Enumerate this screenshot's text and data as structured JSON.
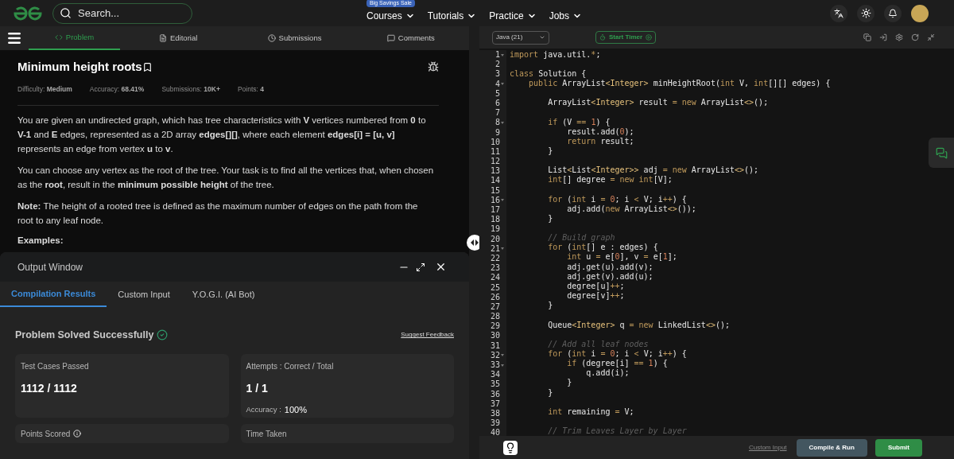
{
  "topbar": {
    "search": {
      "placeholder": "Search..."
    },
    "sale_badge": "Big Savings Sale",
    "nav": [
      {
        "label": "Courses"
      },
      {
        "label": "Tutorials"
      },
      {
        "label": "Practice"
      },
      {
        "label": "Jobs"
      }
    ]
  },
  "problem_tabs": [
    {
      "label": "Problem",
      "selected": true
    },
    {
      "label": "Editorial",
      "selected": false
    },
    {
      "label": "Submissions",
      "selected": false
    },
    {
      "label": "Comments",
      "selected": false
    }
  ],
  "problem": {
    "title": "Minimum height roots",
    "meta": [
      {
        "label": "Difficulty:",
        "value": "Medium"
      },
      {
        "label": "Accuracy:",
        "value": "68.41%"
      },
      {
        "label": "Submissions:",
        "value": "10K+"
      },
      {
        "label": "Points:",
        "value": "4"
      }
    ],
    "paragraphs": [
      "You are given an undirected graph, which has tree characteristics with **V** vertices numbered from **0** to **V-1** and **E** edges, represented as a 2D array **edges[][]**, where each element **edges[i] = [u, v]** represents an edge from vertex **u** to **v**.",
      "You can choose any vertex as the root of the tree. Your task is to find all the vertices that, when chosen as the **root**, result in the **minimum possible height** of the tree.",
      "**Note:** The height of a rooted tree is defined as the maximum number of edges on the path from the root to any leaf node."
    ],
    "examples_heading": "Examples:"
  },
  "output_window": {
    "title": "Output Window",
    "tabs": [
      {
        "label": "Compilation Results",
        "selected": true
      },
      {
        "label": "Custom Input",
        "selected": false
      },
      {
        "label": "Y.O.G.I. (AI Bot)",
        "selected": false
      }
    ],
    "status": "Problem Solved Successfully",
    "feedback_link": "Suggest Feedback",
    "cards": [
      {
        "label": "Test Cases Passed",
        "value": "1112 / 1112"
      },
      {
        "label": "Attempts : Correct / Total",
        "value": "1 / 1",
        "sub_label": "Accuracy :",
        "sub_value": "100%"
      },
      {
        "label": "Points Scored",
        "info": true
      },
      {
        "label": "Time Taken"
      }
    ]
  },
  "editor": {
    "language": "Java (21)",
    "timer_button": "Start Timer",
    "lines": [
      {
        "n": "1",
        "fold": true,
        "tokens": [
          {
            "kind": "kw",
            "text": "import"
          },
          {
            "kind": "plain",
            "text": " java.util."
          },
          {
            "kind": "kw",
            "text": "*"
          },
          {
            "kind": "plain",
            "text": ";"
          }
        ]
      },
      {
        "n": "2",
        "fold": false
      },
      {
        "n": "3",
        "fold": false,
        "tokens": [
          {
            "kind": "kw",
            "text": "class"
          },
          {
            "kind": "plain",
            "text": " Solution {"
          }
        ]
      },
      {
        "n": "4",
        "fold": true,
        "tokens": [
          {
            "kind": "kw",
            "text": "    public"
          },
          {
            "kind": "plain",
            "text": " ArrayList"
          },
          {
            "kind": "type",
            "text": "<Integer>"
          },
          {
            "kind": "plain",
            "text": " minHeightRoot("
          },
          {
            "kind": "kw",
            "text": "int"
          },
          {
            "kind": "plain",
            "text": " V, "
          },
          {
            "kind": "kw",
            "text": "int"
          },
          {
            "kind": "plain",
            "text": "[][] edges) {"
          }
        ]
      },
      {
        "n": "5",
        "fold": false
      },
      {
        "n": "6",
        "fold": false,
        "tokens": [
          {
            "kind": "plain",
            "text": "        ArrayList"
          },
          {
            "kind": "type",
            "text": "<Integer>"
          },
          {
            "kind": "plain",
            "text": " result "
          },
          {
            "kind": "kw",
            "text": "= new"
          },
          {
            "kind": "plain",
            "text": " ArrayList"
          },
          {
            "kind": "type",
            "text": "<>"
          },
          {
            "kind": "plain",
            "text": "();"
          }
        ]
      },
      {
        "n": "7",
        "fold": false
      },
      {
        "n": "8",
        "fold": true,
        "tokens": [
          {
            "kind": "kw",
            "text": "        if"
          },
          {
            "kind": "plain",
            "text": " (V "
          },
          {
            "kind": "kw",
            "text": "== "
          },
          {
            "kind": "num",
            "text": "1"
          },
          {
            "kind": "plain",
            "text": ") {"
          }
        ]
      },
      {
        "n": "9",
        "fold": false,
        "tokens": [
          {
            "kind": "plain",
            "text": "            result.add("
          },
          {
            "kind": "num",
            "text": "0"
          },
          {
            "kind": "plain",
            "text": ");"
          }
        ]
      },
      {
        "n": "10",
        "fold": false,
        "tokens": [
          {
            "kind": "kw",
            "text": "            return"
          },
          {
            "kind": "plain",
            "text": " result;"
          }
        ]
      },
      {
        "n": "11",
        "fold": false,
        "tokens": [
          {
            "kind": "plain",
            "text": "        }"
          }
        ]
      },
      {
        "n": "12",
        "fold": false
      },
      {
        "n": "13",
        "fold": false,
        "tokens": [
          {
            "kind": "plain",
            "text": "        List"
          },
          {
            "kind": "type",
            "text": "<"
          },
          {
            "kind": "plain",
            "text": "List"
          },
          {
            "kind": "type",
            "text": "<Integer>>"
          },
          {
            "kind": "plain",
            "text": " adj "
          },
          {
            "kind": "kw",
            "text": "= new"
          },
          {
            "kind": "plain",
            "text": " ArrayList"
          },
          {
            "kind": "type",
            "text": "<>"
          },
          {
            "kind": "plain",
            "text": "();"
          }
        ]
      },
      {
        "n": "14",
        "fold": false,
        "tokens": [
          {
            "kind": "kw",
            "text": "        int"
          },
          {
            "kind": "plain",
            "text": "[] degree "
          },
          {
            "kind": "kw",
            "text": "= new int"
          },
          {
            "kind": "plain",
            "text": "[V];"
          }
        ]
      },
      {
        "n": "15",
        "fold": false
      },
      {
        "n": "16",
        "fold": true,
        "tokens": [
          {
            "kind": "kw",
            "text": "        for"
          },
          {
            "kind": "plain",
            "text": " ("
          },
          {
            "kind": "kw",
            "text": "int"
          },
          {
            "kind": "plain",
            "text": " i "
          },
          {
            "kind": "kw",
            "text": "= "
          },
          {
            "kind": "num",
            "text": "0"
          },
          {
            "kind": "plain",
            "text": "; i "
          },
          {
            "kind": "kw",
            "text": "<"
          },
          {
            "kind": "plain",
            "text": " V; i"
          },
          {
            "kind": "kw",
            "text": "++"
          },
          {
            "kind": "plain",
            "text": ") {"
          }
        ]
      },
      {
        "n": "17",
        "fold": false,
        "tokens": [
          {
            "kind": "plain",
            "text": "            adj.add("
          },
          {
            "kind": "kw",
            "text": "new"
          },
          {
            "kind": "plain",
            "text": " ArrayList"
          },
          {
            "kind": "type",
            "text": "<>"
          },
          {
            "kind": "plain",
            "text": "());"
          }
        ]
      },
      {
        "n": "18",
        "fold": false,
        "tokens": [
          {
            "kind": "plain",
            "text": "        }"
          }
        ]
      },
      {
        "n": "19",
        "fold": false
      },
      {
        "n": "20",
        "fold": false,
        "tokens": [
          {
            "kind": "comment",
            "text": "        // Build graph"
          }
        ]
      },
      {
        "n": "21",
        "fold": true,
        "tokens": [
          {
            "kind": "kw",
            "text": "        for"
          },
          {
            "kind": "plain",
            "text": " ("
          },
          {
            "kind": "kw",
            "text": "int"
          },
          {
            "kind": "plain",
            "text": "[] e : edges) {"
          }
        ]
      },
      {
        "n": "22",
        "fold": false,
        "tokens": [
          {
            "kind": "kw",
            "text": "            int"
          },
          {
            "kind": "plain",
            "text": " u "
          },
          {
            "kind": "kw",
            "text": "="
          },
          {
            "kind": "plain",
            "text": " e["
          },
          {
            "kind": "num",
            "text": "0"
          },
          {
            "kind": "plain",
            "text": "], v "
          },
          {
            "kind": "kw",
            "text": "="
          },
          {
            "kind": "plain",
            "text": " e["
          },
          {
            "kind": "num",
            "text": "1"
          },
          {
            "kind": "plain",
            "text": "];"
          }
        ]
      },
      {
        "n": "23",
        "fold": false,
        "tokens": [
          {
            "kind": "plain",
            "text": "            adj.get(u).add(v);"
          }
        ]
      },
      {
        "n": "24",
        "fold": false,
        "tokens": [
          {
            "kind": "plain",
            "text": "            adj.get(v).add(u);"
          }
        ]
      },
      {
        "n": "25",
        "fold": false,
        "tokens": [
          {
            "kind": "plain",
            "text": "            degree[u]"
          },
          {
            "kind": "kw",
            "text": "++"
          },
          {
            "kind": "plain",
            "text": ";"
          }
        ]
      },
      {
        "n": "26",
        "fold": false,
        "tokens": [
          {
            "kind": "plain",
            "text": "            degree[v]"
          },
          {
            "kind": "kw",
            "text": "++"
          },
          {
            "kind": "plain",
            "text": ";"
          }
        ]
      },
      {
        "n": "27",
        "fold": false,
        "tokens": [
          {
            "kind": "plain",
            "text": "        }"
          }
        ]
      },
      {
        "n": "28",
        "fold": false
      },
      {
        "n": "29",
        "fold": false,
        "tokens": [
          {
            "kind": "plain",
            "text": "        Queue"
          },
          {
            "kind": "type",
            "text": "<Integer>"
          },
          {
            "kind": "plain",
            "text": " q "
          },
          {
            "kind": "kw",
            "text": "= new"
          },
          {
            "kind": "plain",
            "text": " LinkedList"
          },
          {
            "kind": "type",
            "text": "<>"
          },
          {
            "kind": "plain",
            "text": "();"
          }
        ]
      },
      {
        "n": "30",
        "fold": false
      },
      {
        "n": "31",
        "fold": false,
        "tokens": [
          {
            "kind": "comment",
            "text": "        // Add all leaf nodes"
          }
        ]
      },
      {
        "n": "32",
        "fold": true,
        "tokens": [
          {
            "kind": "kw",
            "text": "        for"
          },
          {
            "kind": "plain",
            "text": " ("
          },
          {
            "kind": "kw",
            "text": "int"
          },
          {
            "kind": "plain",
            "text": " i "
          },
          {
            "kind": "kw",
            "text": "= "
          },
          {
            "kind": "num",
            "text": "0"
          },
          {
            "kind": "plain",
            "text": "; i "
          },
          {
            "kind": "kw",
            "text": "<"
          },
          {
            "kind": "plain",
            "text": " V; i"
          },
          {
            "kind": "kw",
            "text": "++"
          },
          {
            "kind": "plain",
            "text": ") {"
          }
        ]
      },
      {
        "n": "33",
        "fold": true,
        "tokens": [
          {
            "kind": "kw",
            "text": "            if"
          },
          {
            "kind": "plain",
            "text": " (degree[i] "
          },
          {
            "kind": "kw",
            "text": "== "
          },
          {
            "kind": "num",
            "text": "1"
          },
          {
            "kind": "plain",
            "text": ") {"
          }
        ]
      },
      {
        "n": "34",
        "fold": false,
        "tokens": [
          {
            "kind": "plain",
            "text": "                q.add(i);"
          }
        ]
      },
      {
        "n": "35",
        "fold": false,
        "tokens": [
          {
            "kind": "plain",
            "text": "            }"
          }
        ]
      },
      {
        "n": "36",
        "fold": false,
        "tokens": [
          {
            "kind": "plain",
            "text": "        }"
          }
        ]
      },
      {
        "n": "37",
        "fold": false
      },
      {
        "n": "38",
        "fold": false,
        "tokens": [
          {
            "kind": "kw",
            "text": "        int"
          },
          {
            "kind": "plain",
            "text": " remaining "
          },
          {
            "kind": "kw",
            "text": "="
          },
          {
            "kind": "plain",
            "text": " V;"
          }
        ]
      },
      {
        "n": "39",
        "fold": false
      },
      {
        "n": "40",
        "fold": false,
        "tokens": [
          {
            "kind": "comment",
            "text": "        // Trim Leaves Layer by Layer"
          }
        ]
      }
    ],
    "footer": {
      "link": "Custom Input",
      "buttons": [
        {
          "label": "Compile & Run",
          "kind": "secondary"
        },
        {
          "label": "Submit",
          "kind": "primary"
        }
      ]
    }
  }
}
